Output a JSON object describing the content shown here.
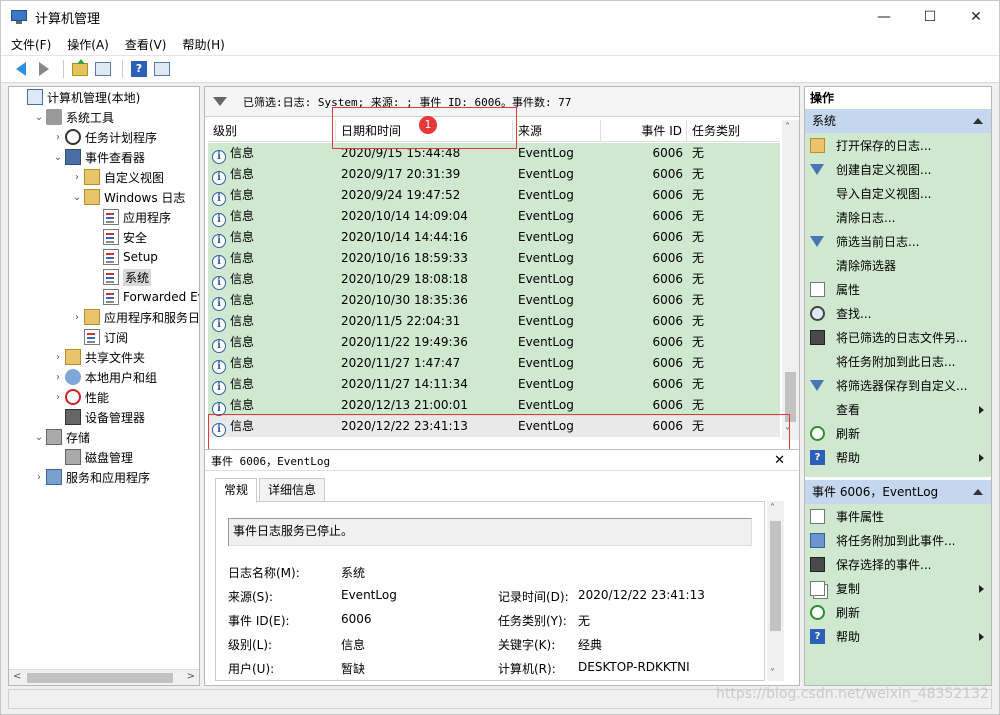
{
  "window": {
    "title": "计算机管理",
    "controls": [
      "—",
      "☐",
      "✕"
    ]
  },
  "menu": [
    "文件(F)",
    "操作(A)",
    "查看(V)",
    "帮助(H)"
  ],
  "tree": [
    {
      "label": "计算机管理(本地)",
      "icon": "computer-icon",
      "depth": 0,
      "toggle": ""
    },
    {
      "label": "系统工具",
      "icon": "tools-icon",
      "depth": 1,
      "toggle": "⌄"
    },
    {
      "label": "任务计划程序",
      "icon": "clock-icon",
      "depth": 2,
      "toggle": "›"
    },
    {
      "label": "事件查看器",
      "icon": "event-viewer-icon",
      "depth": 2,
      "toggle": "⌄"
    },
    {
      "label": "自定义视图",
      "icon": "folder-icon",
      "depth": 3,
      "toggle": "›"
    },
    {
      "label": "Windows 日志",
      "icon": "folder-icon",
      "depth": 3,
      "toggle": "⌄"
    },
    {
      "label": "应用程序",
      "icon": "log-icon",
      "depth": 4,
      "toggle": ""
    },
    {
      "label": "安全",
      "icon": "log-icon",
      "depth": 4,
      "toggle": ""
    },
    {
      "label": "Setup",
      "icon": "log-icon",
      "depth": 4,
      "toggle": ""
    },
    {
      "label": "系统",
      "icon": "log-icon",
      "depth": 4,
      "toggle": "",
      "selected": true
    },
    {
      "label": "Forwarded Eve",
      "icon": "log-icon",
      "depth": 4,
      "toggle": ""
    },
    {
      "label": "应用程序和服务日志",
      "icon": "folder-icon",
      "depth": 3,
      "toggle": "›"
    },
    {
      "label": "订阅",
      "icon": "subscription-icon",
      "depth": 3,
      "toggle": ""
    },
    {
      "label": "共享文件夹",
      "icon": "shared-folder-icon",
      "depth": 2,
      "toggle": "›"
    },
    {
      "label": "本地用户和组",
      "icon": "users-icon",
      "depth": 2,
      "toggle": "›"
    },
    {
      "label": "性能",
      "icon": "performance-icon",
      "depth": 2,
      "toggle": "›"
    },
    {
      "label": "设备管理器",
      "icon": "device-manager-icon",
      "depth": 2,
      "toggle": ""
    },
    {
      "label": "存储",
      "icon": "storage-icon",
      "depth": 1,
      "toggle": "⌄"
    },
    {
      "label": "磁盘管理",
      "icon": "disk-icon",
      "depth": 2,
      "toggle": ""
    },
    {
      "label": "服务和应用程序",
      "icon": "services-icon",
      "depth": 1,
      "toggle": "›"
    }
  ],
  "filter": {
    "text": "已筛选:日志: System; 来源: ; 事件 ID: 6006。事件数: 77"
  },
  "grid": {
    "columns": [
      "级别",
      "日期和时间",
      "来源",
      "事件 ID",
      "任务类别"
    ],
    "rows": [
      [
        "信息",
        "2020/9/15 15:44:48",
        "EventLog",
        "6006",
        "无"
      ],
      [
        "信息",
        "2020/9/17 20:31:39",
        "EventLog",
        "6006",
        "无"
      ],
      [
        "信息",
        "2020/9/24 19:47:52",
        "EventLog",
        "6006",
        "无"
      ],
      [
        "信息",
        "2020/10/14 14:09:04",
        "EventLog",
        "6006",
        "无"
      ],
      [
        "信息",
        "2020/10/14 14:44:16",
        "EventLog",
        "6006",
        "无"
      ],
      [
        "信息",
        "2020/10/16 18:59:33",
        "EventLog",
        "6006",
        "无"
      ],
      [
        "信息",
        "2020/10/29 18:08:18",
        "EventLog",
        "6006",
        "无"
      ],
      [
        "信息",
        "2020/10/30 18:35:36",
        "EventLog",
        "6006",
        "无"
      ],
      [
        "信息",
        "2020/11/5 22:04:31",
        "EventLog",
        "6006",
        "无"
      ],
      [
        "信息",
        "2020/11/22 19:49:36",
        "EventLog",
        "6006",
        "无"
      ],
      [
        "信息",
        "2020/11/27 1:47:47",
        "EventLog",
        "6006",
        "无"
      ],
      [
        "信息",
        "2020/11/27 14:11:34",
        "EventLog",
        "6006",
        "无"
      ],
      [
        "信息",
        "2020/12/13 21:00:01",
        "EventLog",
        "6006",
        "无"
      ],
      [
        "信息",
        "2020/12/22 23:41:13",
        "EventLog",
        "6006",
        "无"
      ]
    ],
    "badge": "1"
  },
  "detail": {
    "title": "事件 6006，EventLog",
    "tabs": [
      "常规",
      "详细信息"
    ],
    "description": "事件日志服务已停止。",
    "fields": {
      "log_name_label": "日志名称(M):",
      "log_name": "系统",
      "source_label": "来源(S):",
      "source": "EventLog",
      "logged_label": "记录时间(D):",
      "logged": "2020/12/22 23:41:13",
      "event_id_label": "事件 ID(E):",
      "event_id": "6006",
      "task_label": "任务类别(Y):",
      "task": "无",
      "level_label": "级别(L):",
      "level": "信息",
      "keywords_label": "关键字(K):",
      "keywords": "经典",
      "user_label": "用户(U):",
      "user": "暂缺",
      "computer_label": "计算机(R):",
      "computer": "DESKTOP-RDKKTNI"
    }
  },
  "actions": {
    "header": "操作",
    "section1": "系统",
    "items1": [
      {
        "label": "打开保存的日志...",
        "icon": "open-folder-icon",
        "sub": false
      },
      {
        "label": "创建自定义视图...",
        "icon": "create-filter-icon",
        "sub": false
      },
      {
        "label": "导入自定义视图...",
        "icon": "",
        "sub": false
      },
      {
        "label": "清除日志...",
        "icon": "",
        "sub": false
      },
      {
        "label": "筛选当前日志...",
        "icon": "filter-icon",
        "sub": false
      },
      {
        "label": "清除筛选器",
        "icon": "",
        "sub": false
      },
      {
        "label": "属性",
        "icon": "properties-icon",
        "sub": false
      },
      {
        "label": "查找...",
        "icon": "find-icon",
        "sub": false
      },
      {
        "label": "将已筛选的日志文件另...",
        "icon": "save-icon",
        "sub": false
      },
      {
        "label": "将任务附加到此日志...",
        "icon": "",
        "sub": false
      },
      {
        "label": "将筛选器保存到自定义...",
        "icon": "save-filter-icon",
        "sub": false
      },
      {
        "label": "查看",
        "icon": "",
        "sub": true
      },
      {
        "label": "刷新",
        "icon": "refresh-icon",
        "sub": false
      },
      {
        "label": "帮助",
        "icon": "help-icon",
        "sub": true
      }
    ],
    "section2": "事件 6006，EventLog",
    "items2": [
      {
        "label": "事件属性",
        "icon": "event-properties-icon",
        "sub": false
      },
      {
        "label": "将任务附加到此事件...",
        "icon": "attach-task-icon",
        "sub": false
      },
      {
        "label": "保存选择的事件...",
        "icon": "save-icon",
        "sub": false
      },
      {
        "label": "复制",
        "icon": "copy-icon",
        "sub": true
      },
      {
        "label": "刷新",
        "icon": "refresh-icon",
        "sub": false
      },
      {
        "label": "帮助",
        "icon": "help-icon",
        "sub": true
      }
    ]
  },
  "watermark": "https://blog.csdn.net/weixin_48352132"
}
